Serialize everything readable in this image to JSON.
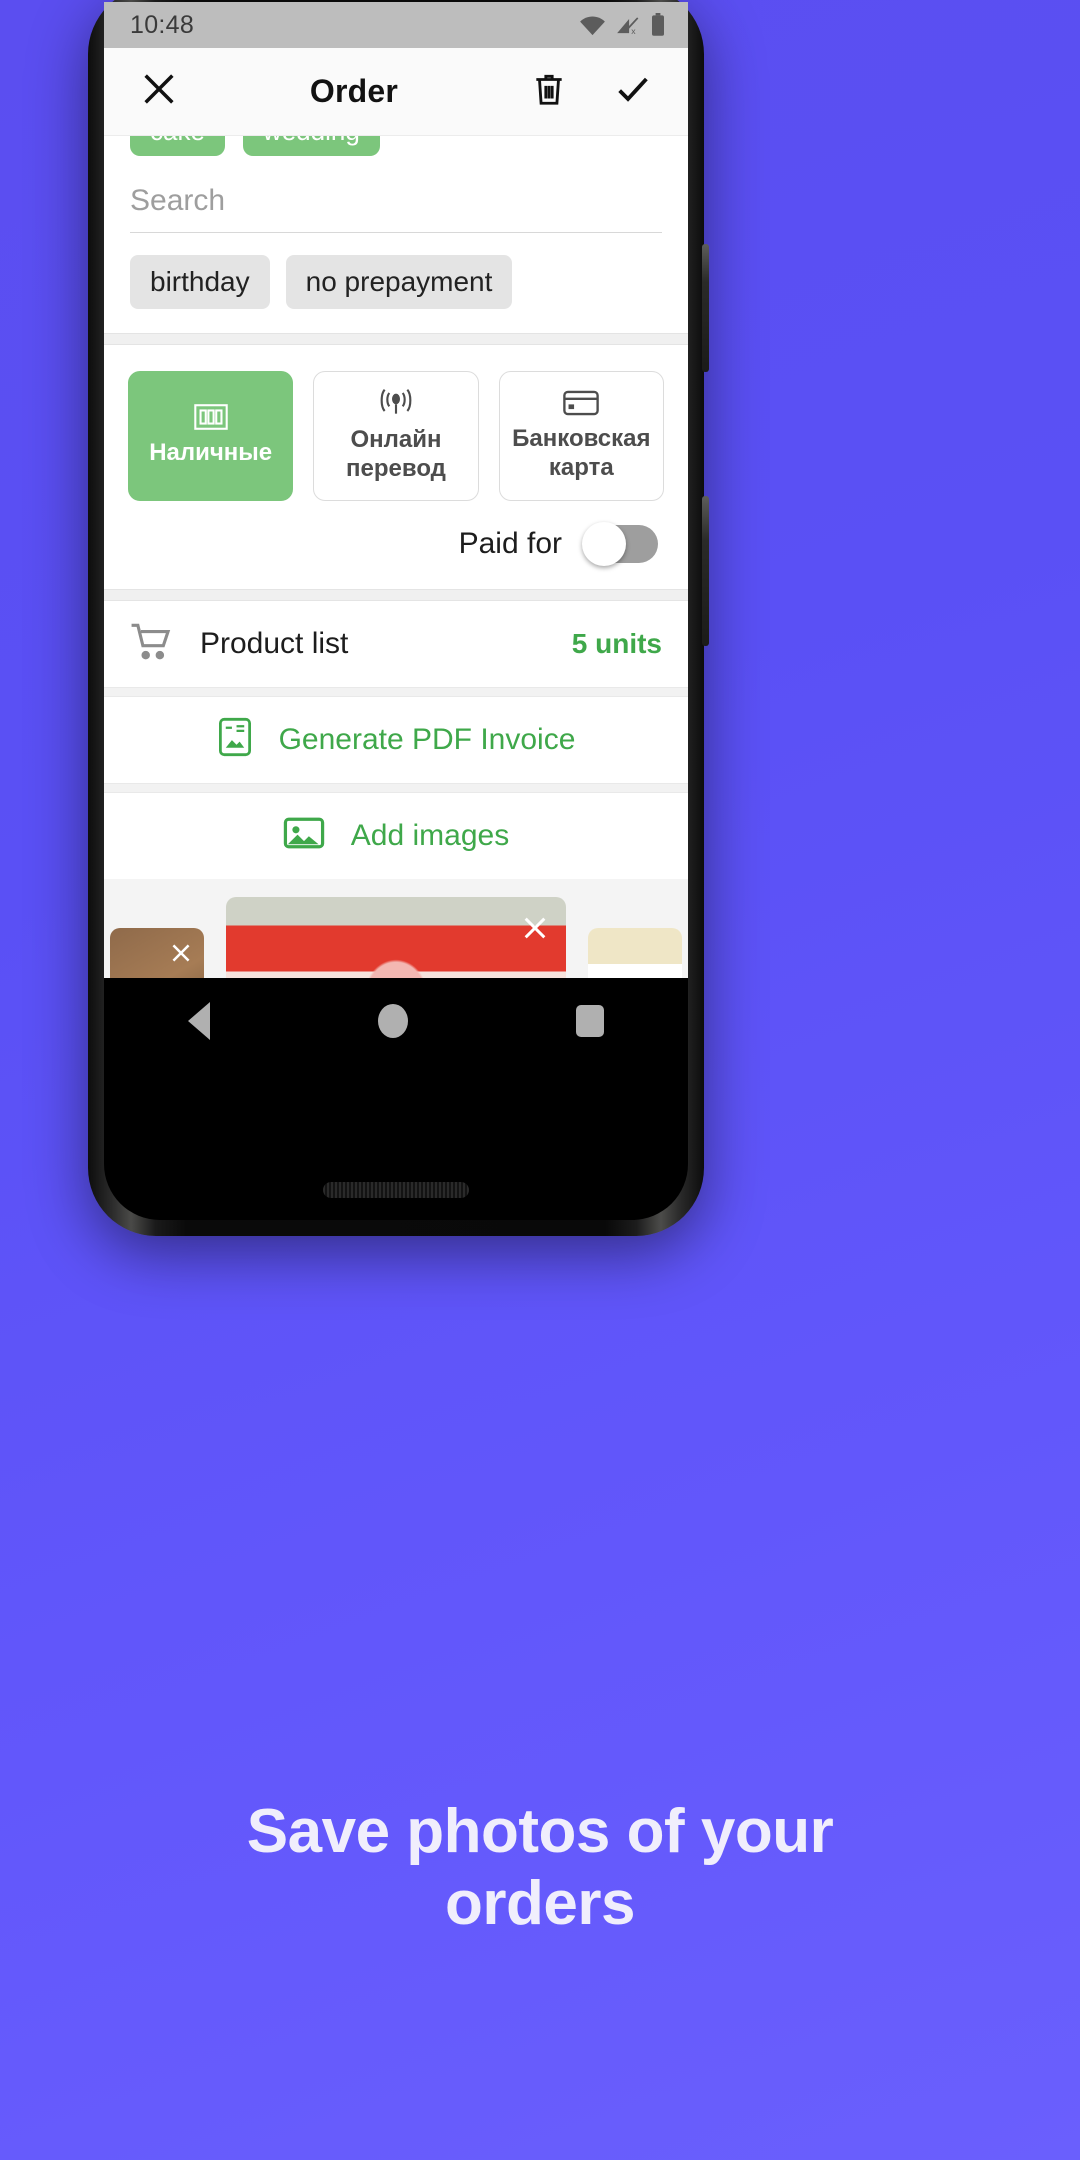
{
  "statusbar": {
    "time": "10:48",
    "icons": [
      "wifi-icon",
      "cellular-no-signal-icon",
      "battery-icon"
    ]
  },
  "appbar": {
    "close_icon": "close-icon",
    "title": "Order",
    "delete_icon": "trash-icon",
    "confirm_icon": "check-icon"
  },
  "tags": {
    "selected": [
      {
        "label": "cake"
      },
      {
        "label": "wedding"
      }
    ],
    "search_placeholder": "Search",
    "search_value": "",
    "suggestions": [
      {
        "label": "birthday"
      },
      {
        "label": "no prepayment"
      }
    ]
  },
  "payment": {
    "methods": [
      {
        "label": "Наличные",
        "icon": "banknote-icon",
        "selected": true
      },
      {
        "label": "Онлайн перевод",
        "icon": "contactless-icon",
        "selected": false
      },
      {
        "label": "Банковская карта",
        "icon": "credit-card-icon",
        "selected": false
      }
    ],
    "paid_label": "Paid for",
    "paid_state": "off"
  },
  "rows": {
    "product_list": {
      "icon": "shopping-cart-icon",
      "label": "Product list",
      "count": "5 units"
    },
    "invoice": {
      "icon": "pdf-invoice-icon",
      "label": "Generate PDF Invoice"
    },
    "add_images": {
      "icon": "image-icon",
      "label": "Add images"
    }
  },
  "carousel": {
    "slides": [
      {
        "alt": "cake-photo-1",
        "remove_icon": "close-icon"
      },
      {
        "alt": "red-velvet-cake-photo",
        "remove_icon": "close-icon"
      },
      {
        "alt": "cake-photo-3",
        "remove_icon": "close-icon"
      }
    ],
    "active_index": 1,
    "dot_count": 3
  },
  "navbar": {
    "back_icon": "back-triangle-icon",
    "home_icon": "home-circle-icon",
    "recents_icon": "recents-square-icon"
  },
  "promo": {
    "line1": "Save photos of your",
    "line2": "orders"
  },
  "colors": {
    "accent_green": "#7cc67c",
    "link_green": "#3fa84a",
    "background_blue": "#5b4ef0",
    "statusbar_gray": "#bdbdbd"
  }
}
